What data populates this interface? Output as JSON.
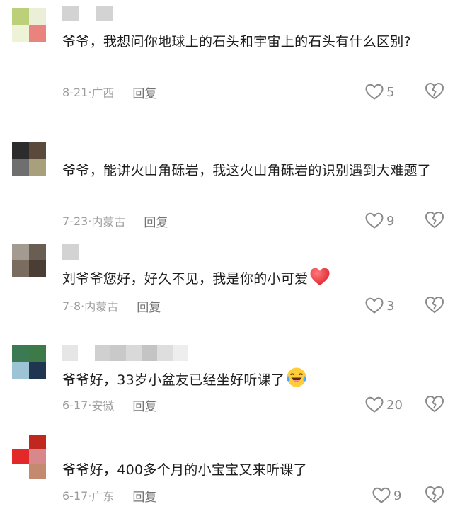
{
  "comments": [
    {
      "avatar_colors": [
        "#bcd07a",
        "#ecefd7",
        "#eef2d6",
        "#e8837e"
      ],
      "name_blocks": [
        "#d3d3d3",
        "#ffffff",
        "#d3d3d3"
      ],
      "text": "爷爷，我想问你地球上的石头和宇宙上的石头有什么区别?",
      "date": "8-21",
      "location": "广西",
      "reply_label": "回复",
      "likes": "5"
    },
    {
      "avatar_colors": [
        "#2c2c2c",
        "#5a4a3c",
        "#6f6f6f",
        "#a8a07c"
      ],
      "name_blocks": [],
      "text": "爷爷，能讲火山角砾岩，我这火山角砾岩的识别遇到大难题了",
      "date": "7-23",
      "location": "内蒙古",
      "reply_label": "回复",
      "likes": "9"
    },
    {
      "avatar_colors": [
        "#a39a91",
        "#6a5d52",
        "#7b6c60",
        "#4a3d33"
      ],
      "name_blocks": [
        "#d3d3d3"
      ],
      "text": "刘爷爷您好，好久不见，我是你的小可爱",
      "emoji": "heart",
      "date": "7-8",
      "location": "内蒙古",
      "reply_label": "回复",
      "likes": "3"
    },
    {
      "avatar_colors": [
        "#3b7a52",
        "#3d7a48",
        "#9cc4d6",
        "#1f3550"
      ],
      "name_blocks": [
        "#e6e6e6",
        "#ffffff",
        "#d0d0d0",
        "#c9c9c9",
        "#d9d9d9",
        "#c4c4c4",
        "#dedede",
        "#eeeeee"
      ],
      "text": "爷爷好，33岁小盆友已经坐好听课了",
      "emoji": "crying-laugh",
      "date": "6-17",
      "location": "安徽",
      "reply_label": "回复",
      "likes": "20"
    },
    {
      "avatar_colors": [
        "#ffffff",
        "#c0281f",
        "#e3282a",
        "#d8878a",
        "#c38a70"
      ],
      "name_blocks": [],
      "text": "爷爷好，400多个月的小宝宝又来听课了",
      "date": "6-17",
      "location": "广东",
      "reply_label": "回复",
      "likes": "9"
    }
  ],
  "colors": {
    "text": "#1c1c1c",
    "meta": "#9d9d9d",
    "reply": "#737373",
    "icon": "#8a8a8a",
    "heart_emoji": "#e8383d"
  }
}
